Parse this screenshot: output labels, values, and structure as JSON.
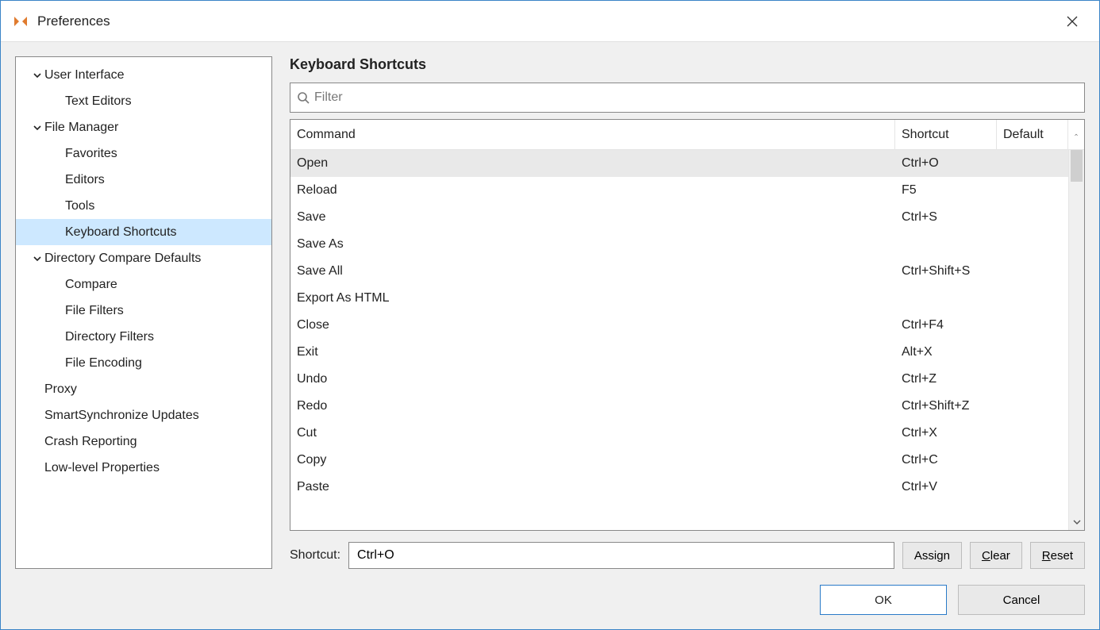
{
  "window": {
    "title": "Preferences"
  },
  "sidebar": {
    "items": [
      {
        "label": "User Interface",
        "level": 1,
        "expandable": true,
        "expanded": true
      },
      {
        "label": "Text Editors",
        "level": 2
      },
      {
        "label": "File Manager",
        "level": 1,
        "expandable": true,
        "expanded": true
      },
      {
        "label": "Favorites",
        "level": 2
      },
      {
        "label": "Editors",
        "level": 2
      },
      {
        "label": "Tools",
        "level": 2
      },
      {
        "label": "Keyboard Shortcuts",
        "level": 2,
        "selected": true
      },
      {
        "label": "Directory Compare Defaults",
        "level": 1,
        "expandable": true,
        "expanded": true
      },
      {
        "label": "Compare",
        "level": 2
      },
      {
        "label": "File Filters",
        "level": 2
      },
      {
        "label": "Directory Filters",
        "level": 2
      },
      {
        "label": "File Encoding",
        "level": 2
      },
      {
        "label": "Proxy",
        "level": 1
      },
      {
        "label": "SmartSynchronize Updates",
        "level": 1
      },
      {
        "label": "Crash Reporting",
        "level": 1
      },
      {
        "label": "Low-level Properties",
        "level": 1
      }
    ]
  },
  "main": {
    "page_title": "Keyboard Shortcuts",
    "filter_placeholder": "Filter",
    "columns": {
      "command": "Command",
      "shortcut": "Shortcut",
      "default": "Default"
    },
    "rows": [
      {
        "command": "Open",
        "shortcut": "Ctrl+O",
        "default": "",
        "selected": true
      },
      {
        "command": "Reload",
        "shortcut": "F5",
        "default": ""
      },
      {
        "command": "Save",
        "shortcut": "Ctrl+S",
        "default": ""
      },
      {
        "command": "Save As",
        "shortcut": "",
        "default": ""
      },
      {
        "command": "Save All",
        "shortcut": "Ctrl+Shift+S",
        "default": ""
      },
      {
        "command": "Export As HTML",
        "shortcut": "",
        "default": ""
      },
      {
        "command": "Close",
        "shortcut": "Ctrl+F4",
        "default": ""
      },
      {
        "command": "Exit",
        "shortcut": "Alt+X",
        "default": ""
      },
      {
        "command": "Undo",
        "shortcut": "Ctrl+Z",
        "default": ""
      },
      {
        "command": "Redo",
        "shortcut": "Ctrl+Shift+Z",
        "default": ""
      },
      {
        "command": "Cut",
        "shortcut": "Ctrl+X",
        "default": ""
      },
      {
        "command": "Copy",
        "shortcut": "Ctrl+C",
        "default": ""
      },
      {
        "command": "Paste",
        "shortcut": "Ctrl+V",
        "default": ""
      }
    ],
    "shortcut_label": "Shortcut:",
    "shortcut_value": "Ctrl+O",
    "buttons": {
      "assign": "Assign",
      "clear_prefix": "C",
      "clear_rest": "lear",
      "reset_prefix": "R",
      "reset_rest": "eset"
    }
  },
  "footer": {
    "ok": "OK",
    "cancel": "Cancel"
  }
}
